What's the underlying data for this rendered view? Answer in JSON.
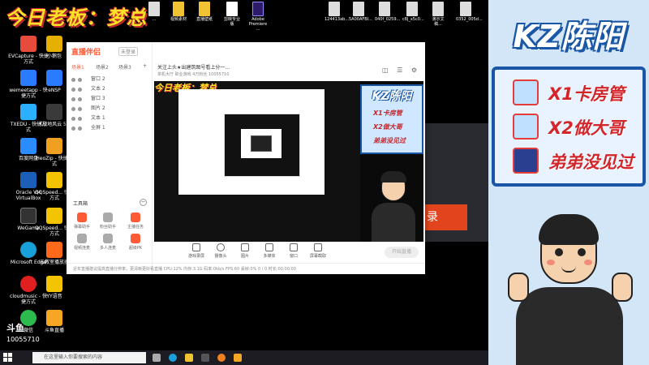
{
  "banner": {
    "text": "今日老板：梦总"
  },
  "top_files": [
    {
      "label": "...",
      "color": "#ddd"
    },
    {
      "label": "视频素材",
      "color": "#f1c232"
    },
    {
      "label": "直播壁纸",
      "color": "#f1c232"
    },
    {
      "label": "剪映专业版",
      "color": "#ffffff"
    },
    {
      "label": "Adobe Premiere ...",
      "color": "#2e1a6b"
    },
    {
      "label": "124413ab...",
      "color": "#eee"
    },
    {
      "label": "5A00AFBI...",
      "color": "#eee"
    },
    {
      "label": "040f_0259...",
      "color": "#eee"
    },
    {
      "label": "c8j_x5c0...",
      "color": "#eee"
    },
    {
      "label": "演示文稿...",
      "color": "#eee"
    },
    {
      "label": "0352_005d...",
      "color": "#eee"
    }
  ],
  "desktop_icons": [
    {
      "label": "EVCapture - 快捷方式",
      "color": "#e84b3c"
    },
    {
      "label": "小鹅包",
      "color": "#e6b000"
    },
    {
      "label": "wemeetapp - 快捷方式",
      "color": "#2a7bff"
    },
    {
      "label": "eNSP",
      "color": "#2a7bff"
    },
    {
      "label": "TXEDU - 快捷方式",
      "color": "#2ab0ff"
    },
    {
      "label": "《战地风云 5》",
      "color": "#3a3a3a"
    },
    {
      "label": "百度网盘",
      "color": "#2a8cff"
    },
    {
      "label": "HeoZip - 快捷方式",
      "color": "#f0a020"
    },
    {
      "label": "Oracle VM VirtualBox",
      "color": "#1c5fb8"
    },
    {
      "label": "QQSpeed... 快捷方式",
      "color": "#f4c400"
    },
    {
      "label": "WeGame",
      "color": "#333333"
    },
    {
      "label": "QQSpeed... 快捷方式",
      "color": "#f4c400"
    },
    {
      "label": "Microsoft Edge",
      "color": "#1aa0d8"
    },
    {
      "label": "云教室播放器",
      "color": "#ff6a1a"
    },
    {
      "label": "cloudmusic - 快捷方式",
      "color": "#e02020"
    },
    {
      "label": "YY语音",
      "color": "#f4c400"
    },
    {
      "label": "微信",
      "color": "#2dbb4f"
    },
    {
      "label": "斗鱼直播",
      "color": "#f5a623"
    }
  ],
  "taskbar": {
    "search_placeholder": "在这里输入你要搜索的内容"
  },
  "watermark": {
    "brand": "斗鱼",
    "room": "10055710"
  },
  "app": {
    "logo": "直播伴侣",
    "badge": "未登录",
    "scene_tabs": [
      "场景1",
      "场景2",
      "场景3"
    ],
    "layers": [
      {
        "label": "窗口 2"
      },
      {
        "label": "文本 2"
      },
      {
        "label": "窗口 3"
      },
      {
        "label": "图片 2"
      },
      {
        "label": "文本 1"
      },
      {
        "label": "全屏 1"
      }
    ],
    "tools_title": "工具箱",
    "tools": [
      {
        "label": "弹幕助手",
        "color": "#ff5a36"
      },
      {
        "label": "粉丝助手",
        "color": "#aaa"
      },
      {
        "label": "主播任务",
        "color": "#ff5a36"
      },
      {
        "label": "视频连麦",
        "color": "#aaa"
      },
      {
        "label": "多人连麦",
        "color": "#aaa"
      },
      {
        "label": "超级PK",
        "color": "#ff5a36"
      },
      {
        "label": "虚拟形象",
        "color": "#aaa"
      },
      {
        "label": "语音房",
        "color": "#aaa"
      },
      {
        "label": "直播设置",
        "color": "#aaa"
      },
      {
        "label": "直播助手",
        "color": "#ff5a36"
      },
      {
        "label": "更多工具",
        "color": "#aaa"
      },
      {
        "label": "互动",
        "color": "#aaa"
      }
    ],
    "head_title": "关注上头★出建筑图号看上分一...",
    "head_sub": "单机大厅  职业游戏  4万粉丝  10055710",
    "head_btns": "◫ ☰ ⚙",
    "bottom_tools": [
      "游戏录屏",
      "摄像头",
      "图片",
      "多媒体",
      "窗口",
      "屏幕截取"
    ],
    "golive": "开始直播",
    "status": "近年直播建议提高直播分辨率，更清晰更好看直播  CPU:12%  内存:3.1G  码率:0kb/s  FPS:60  丢帧:0%  0 / 0  时长:00:00:00"
  },
  "dialog": {
    "button": "录"
  },
  "mini_panel": {
    "title": "KZ陈阳",
    "rows": [
      "X1卡房管",
      "X2做大哥",
      "弟弟没见过"
    ]
  },
  "right_panel": {
    "title": "KZ陈阳",
    "rows": [
      {
        "label": "X1卡房管"
      },
      {
        "label": "X2做大哥"
      },
      {
        "label": "弟弟没见过"
      }
    ]
  }
}
